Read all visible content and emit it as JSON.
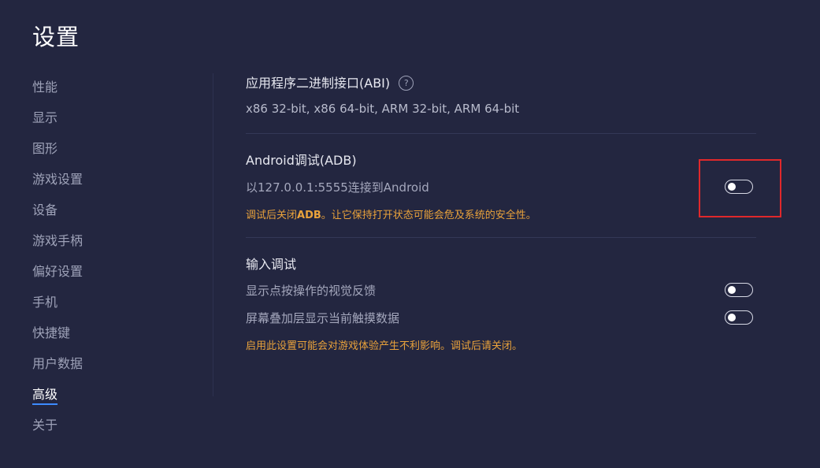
{
  "page": {
    "title": "设置"
  },
  "sidebar": {
    "items": [
      {
        "label": "性能",
        "active": false
      },
      {
        "label": "显示",
        "active": false
      },
      {
        "label": "图形",
        "active": false
      },
      {
        "label": "游戏设置",
        "active": false
      },
      {
        "label": "设备",
        "active": false
      },
      {
        "label": "游戏手柄",
        "active": false
      },
      {
        "label": "偏好设置",
        "active": false
      },
      {
        "label": "手机",
        "active": false
      },
      {
        "label": "快捷键",
        "active": false
      },
      {
        "label": "用户数据",
        "active": false
      },
      {
        "label": "高级",
        "active": true
      },
      {
        "label": "关于",
        "active": false
      }
    ]
  },
  "abi": {
    "title": "应用程序二进制接口(ABI)",
    "help_icon": "?",
    "values": "x86 32-bit, x86 64-bit, ARM 32-bit, ARM 64-bit"
  },
  "adb": {
    "title": "Android调试(ADB)",
    "description": "以127.0.0.1:5555连接到Android",
    "toggle_on": false,
    "warning_prefix": "调试后关闭",
    "warning_strong": "ADB",
    "warning_suffix": "。让它保持打开状态可能会危及系统的安全性。"
  },
  "input_debug": {
    "title": "输入调试",
    "option1_label": "显示点按操作的视觉反馈",
    "option1_on": false,
    "option2_label": "屏幕叠加层显示当前触摸数据",
    "option2_on": false,
    "warning": "启用此设置可能会对游戏体验产生不利影响。调试后请关闭。"
  },
  "colors": {
    "background": "#232640",
    "accent": "#3d8bff",
    "warning": "#e9a23b",
    "highlight": "#e0282b"
  }
}
